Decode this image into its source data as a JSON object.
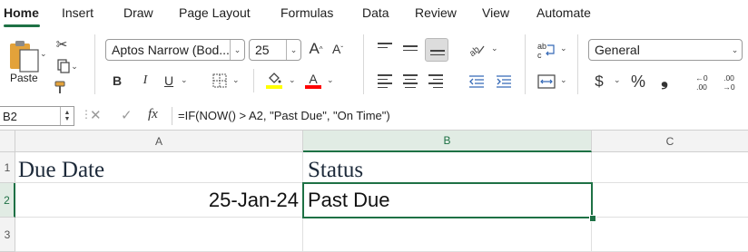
{
  "tabs": [
    "Home",
    "Insert",
    "Draw",
    "Page Layout",
    "Formulas",
    "Data",
    "Review",
    "View",
    "Automate"
  ],
  "ribbon": {
    "paste_label": "Paste",
    "font_name": "Aptos Narrow (Bod...",
    "font_size": "25",
    "bold": "B",
    "italic": "I",
    "underline": "U",
    "number_format": "General",
    "currency": "$",
    "percent": "%",
    "comma": "❟",
    "inc_decimal": "←0 .00",
    "dec_decimal": ".00 →0",
    "grow_font": "A",
    "shrink_font": "A",
    "fill_color": "#ffff00",
    "font_color": "#ff0000"
  },
  "formula_bar": {
    "name_box": "B2",
    "fx": "fx",
    "formula": "=IF(NOW() > A2, \"Past Due\", \"On Time\")"
  },
  "sheet": {
    "columns": [
      "A",
      "B",
      "C"
    ],
    "rows": [
      "1",
      "2",
      "3"
    ],
    "cells": {
      "A1": "Due Date",
      "B1": "Status",
      "A2": "25-Jan-24",
      "B2": "Past Due"
    },
    "selected_cell": "B2"
  },
  "colors": {
    "accent": "#1e7145",
    "selection_header": "#e1ece4"
  }
}
